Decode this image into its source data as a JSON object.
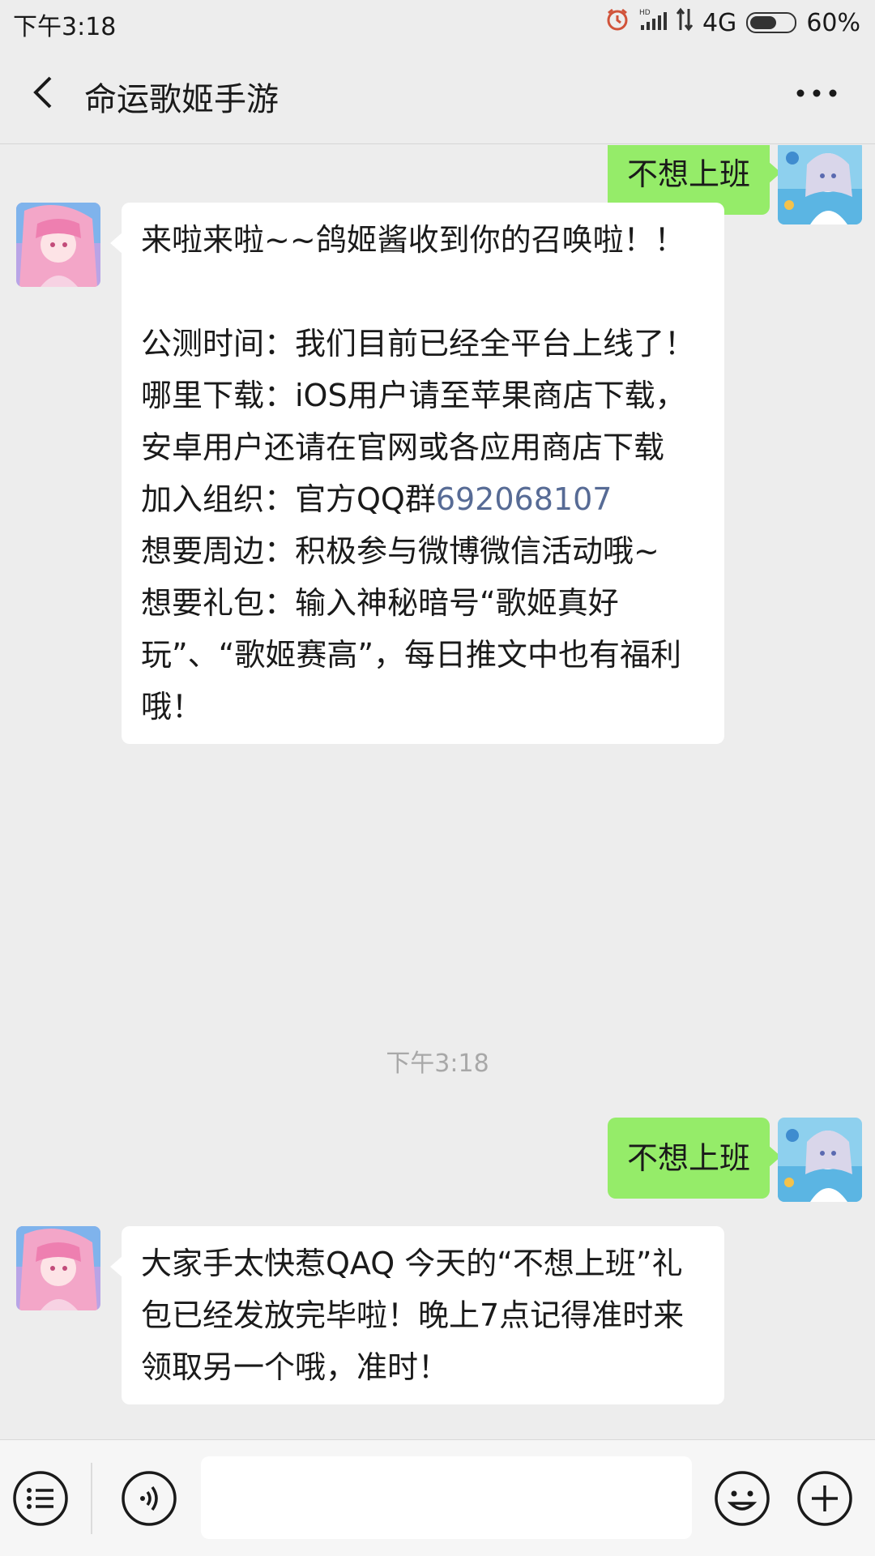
{
  "status_bar": {
    "time": "下午3:18",
    "network": "4G",
    "battery": "60%",
    "battery_level": 0.6,
    "icons": [
      "alarm-icon",
      "hd-signal-icon",
      "data-arrows-icon",
      "battery-icon"
    ]
  },
  "header": {
    "title": "命运歌姬手游",
    "back_icon": "chevron-left-icon",
    "more_icon": "more-dots-icon"
  },
  "messages": [
    {
      "side": "sent",
      "text": "不想上班"
    },
    {
      "side": "received",
      "lines": [
        "来啦来啦~~鸽姬酱收到你的召唤啦！！",
        "",
        "公测时间：我们目前已经全平台上线了！",
        "哪里下载：iOS用户请至苹果商店下载，安卓用户还请在官网或各应用商店下载",
        "加入组织：官方QQ群",
        "想要周边：积极参与微博微信活动哦~",
        "想要礼包：输入神秘暗号“歌姬真好玩”、“歌姬赛高”，每日推文中也有福利哦！"
      ],
      "qq_group_number": "692068107"
    },
    {
      "side": "divider",
      "text": "下午3:18"
    },
    {
      "side": "sent",
      "text": "不想上班"
    },
    {
      "side": "received",
      "text": "大家手太快惹QAQ 今天的“不想上班”礼包已经发放完毕啦！晚上7点记得准时来领取另一个哦，准时！"
    }
  ],
  "input_bar": {
    "menu_icon": "list-menu-icon",
    "voice_icon": "voice-icon",
    "input_value": "",
    "emoji_icon": "emoji-icon",
    "plus_icon": "plus-icon"
  },
  "colors": {
    "sent_bubble": "#95ec69",
    "received_bubble": "#ffffff",
    "background": "#ededed",
    "link": "#576b95"
  }
}
